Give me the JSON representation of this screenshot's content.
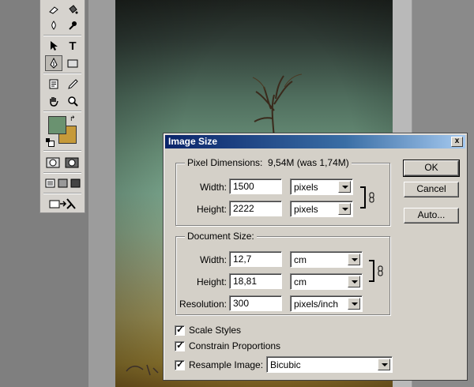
{
  "dialog": {
    "title": "Image Size",
    "close_glyph": "x",
    "pixel_dimensions": {
      "label": "Pixel Dimensions:",
      "summary": "9,54M (was 1,74M)",
      "width_label": "Width:",
      "width_value": "1500",
      "width_unit": "pixels",
      "height_label": "Height:",
      "height_value": "2222",
      "height_unit": "pixels"
    },
    "document_size": {
      "label": "Document Size:",
      "width_label": "Width:",
      "width_value": "12,7",
      "width_unit": "cm",
      "height_label": "Height:",
      "height_value": "18,81",
      "height_unit": "cm",
      "resolution_label": "Resolution:",
      "resolution_value": "300",
      "resolution_unit": "pixels/inch"
    },
    "options": {
      "scale_styles": "Scale Styles",
      "constrain_proportions": "Constrain Proportions",
      "resample_image": "Resample Image:",
      "resample_method": "Bicubic"
    },
    "buttons": {
      "ok": "OK",
      "cancel": "Cancel",
      "auto": "Auto..."
    }
  },
  "colors": {
    "foreground": "#6a9270",
    "background": "#c69a3a",
    "titlebar_start": "#0a246a",
    "titlebar_end": "#a6caf0",
    "dialog_face": "#d4d0c8"
  },
  "toolbox": {
    "tools": [
      "eraser-icon",
      "paint-bucket-icon",
      "blur-icon",
      "dodge-icon",
      "path-select-icon",
      "type-icon",
      "pen-icon",
      "rectangle-icon",
      "notes-icon",
      "eyedropper-icon",
      "hand-icon",
      "zoom-icon",
      "quick-mask-icon",
      "screen-mode-icon",
      "jump-to-icon"
    ]
  }
}
